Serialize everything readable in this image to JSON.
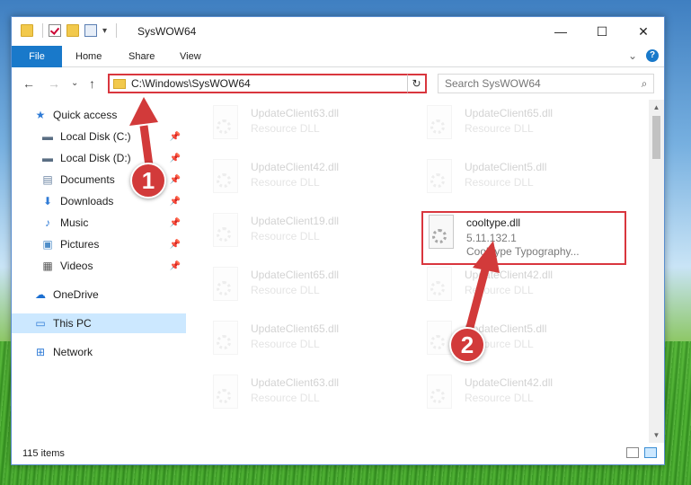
{
  "window": {
    "title": "SysWOW64",
    "minimize": "—",
    "maximize": "☐",
    "close": "✕"
  },
  "ribbon": {
    "tabs": [
      "File",
      "Home",
      "Share",
      "View"
    ],
    "expand": "⌄",
    "help": "?"
  },
  "nav": {
    "back": "←",
    "forward": "→",
    "recent": "⌄",
    "up": "↑"
  },
  "address": {
    "path": "C:\\Windows\\SysWOW64",
    "dropdown": "⌄",
    "refresh": "↻"
  },
  "search": {
    "placeholder": "Search SysWOW64"
  },
  "sidebar": {
    "items": [
      {
        "label": "Quick access",
        "icon": "star-icon",
        "glyph": "★",
        "color": "#2f7bd6",
        "pinned": false
      },
      {
        "label": "Local Disk (C:)",
        "icon": "drive-icon",
        "glyph": "▬",
        "color": "#5a6e83",
        "pinned": true
      },
      {
        "label": "Local Disk (D:)",
        "icon": "drive-icon",
        "glyph": "▬",
        "color": "#5a6e83",
        "pinned": true
      },
      {
        "label": "Documents",
        "icon": "documents-icon",
        "glyph": "▤",
        "color": "#6b84a3",
        "pinned": true
      },
      {
        "label": "Downloads",
        "icon": "download-icon",
        "glyph": "⬇",
        "color": "#2f7bd6",
        "pinned": true
      },
      {
        "label": "Music",
        "icon": "music-icon",
        "glyph": "♪",
        "color": "#2f7bd6",
        "pinned": true
      },
      {
        "label": "Pictures",
        "icon": "pictures-icon",
        "glyph": "▣",
        "color": "#4f8ec9",
        "pinned": true
      },
      {
        "label": "Videos",
        "icon": "videos-icon",
        "glyph": "▦",
        "color": "#555555",
        "pinned": true
      },
      {
        "label": "OneDrive",
        "icon": "cloud-icon",
        "glyph": "☁",
        "color": "#1c6fd1",
        "pinned": false
      },
      {
        "label": "This PC",
        "icon": "computer-icon",
        "glyph": "▭",
        "color": "#2f7bd6",
        "pinned": false
      },
      {
        "label": "Network",
        "icon": "network-icon",
        "glyph": "⊞",
        "color": "#2f7bd6",
        "pinned": false
      }
    ]
  },
  "files": [
    {
      "name": "UpdateClient63.dll",
      "type": "Resource DLL"
    },
    {
      "name": "UpdateClient65.dll",
      "type": "Resource DLL"
    },
    {
      "name": "UpdateClient42.dll",
      "type": "Resource DLL"
    },
    {
      "name": "UpdateClient5.dll",
      "type": "Resource DLL"
    },
    {
      "name": "UpdateClient19.dll",
      "type": "Resource DLL"
    },
    {
      "name": "cooltype.dll",
      "version": "5.11.132.1",
      "type": "CoolType Typography..."
    },
    {
      "name": "UpdateClient65.dll",
      "type": "Resource DLL"
    },
    {
      "name": "UpdateClient42.dll",
      "type": "Resource DLL"
    },
    {
      "name": "UpdateClient65.dll",
      "type": "Resource DLL"
    },
    {
      "name": "UpdateClient5.dll",
      "type": "Resource DLL"
    },
    {
      "name": "UpdateClient63.dll",
      "type": "Resource DLL"
    },
    {
      "name": "UpdateClient42.dll",
      "type": "Resource DLL"
    }
  ],
  "status": {
    "item_count": "115 items"
  },
  "callouts": [
    "1",
    "2"
  ],
  "colors": {
    "highlight": "#d9363e",
    "accent": "#1979ca",
    "selection": "#cce8ff"
  }
}
